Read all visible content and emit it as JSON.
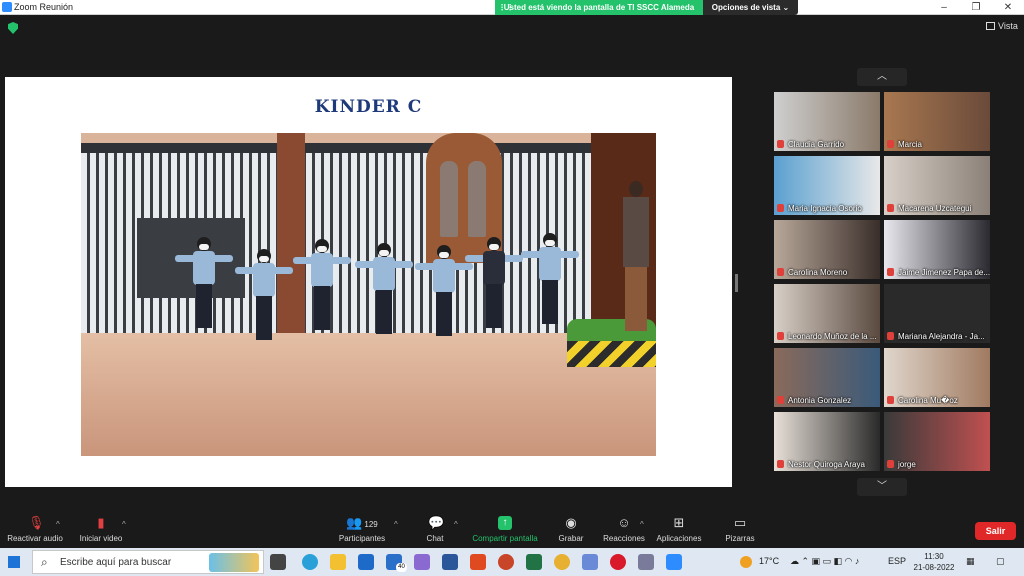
{
  "window": {
    "title": "Zoom Reunión",
    "minimize": "–",
    "maximize": "❐",
    "close": "✕"
  },
  "banner": {
    "text": "Usted está viendo la pantalla de TI SSCC Alameda",
    "view_options": "Opciones de vista ⌄"
  },
  "top_right": {
    "view_label": "Vista"
  },
  "slide": {
    "title": "KINDER  C"
  },
  "panel": {
    "up_arrow": "︿",
    "down_arrow": "﹀",
    "participants": [
      {
        "name": "Claudia Garrido"
      },
      {
        "name": "Marcia"
      },
      {
        "name": "Maria Ignacia Osorio"
      },
      {
        "name": "Macarena Uzcategui"
      },
      {
        "name": "Carolina Moreno"
      },
      {
        "name": "Jaime Jimenez Papa de..."
      },
      {
        "name": "Leonardo Muñoz de la ..."
      },
      {
        "name": "Mariana Alejandra  - Ja..."
      },
      {
        "name": "Antonia Gonzalez"
      },
      {
        "name": "Carolina Mu�oz"
      },
      {
        "name": "Nestor Quiroga Araya"
      },
      {
        "name": "jorge"
      }
    ]
  },
  "toolbar": {
    "audio": "Reactivar audio",
    "video": "Iniciar video",
    "participants": "Participantes",
    "participants_count": "129",
    "chat": "Chat",
    "share": "Compartir pantalla",
    "record": "Grabar",
    "reactions": "Reacciones",
    "apps": "Aplicaciones",
    "whiteboards": "Pizarras",
    "leave": "Salir"
  },
  "taskbar": {
    "search_placeholder": "Escribe aquí para buscar",
    "mail_badge": "40",
    "weather": "17°C",
    "language": "ESP",
    "time": "11:30",
    "date": "21-08-2022"
  },
  "colors": {
    "accent_green": "#23c26b",
    "leave_red": "#e02828",
    "slide_title": "#1f3a7a"
  }
}
